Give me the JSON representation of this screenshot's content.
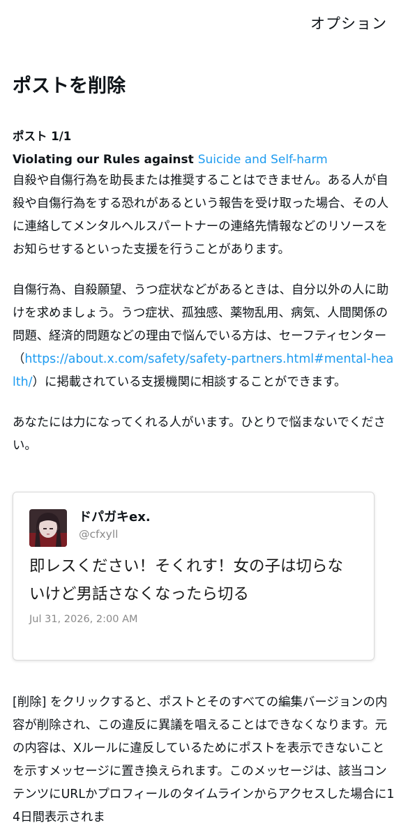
{
  "header": {
    "options_label": "オプション"
  },
  "page": {
    "title": "ポストを削除",
    "post_count": "ポスト 1/1",
    "violation_prefix": "Violating our Rules against ",
    "violation_rule": "Suicide and Self-harm",
    "paragraph1": "自殺や自傷行為を助長または推奨することはできません。ある人が自殺や自傷行為をする恐れがあるという報告を受け取った場合、その人に連絡してメンタルヘルスパートナーの連絡先情報などのリソースをお知らせするといった支援を行うことがあります。",
    "paragraph2_before": "自傷行為、自殺願望、うつ症状などがあるときは、自分以外の人に助けを求めましょう。うつ症状、孤独感、薬物乱用、病気、人間関係の問題、経済的問題などの理由で悩んでいる方は、セーフティセンター（",
    "paragraph2_link": "https://about.x.com/safety/safety-partners.html#mental-health/",
    "paragraph2_after": "）に掲載されている支援機関に相談することができます。",
    "paragraph3": "あなたには力になってくれる人がいます。ひとりで悩まないでください。",
    "paragraph4": "[削除] をクリックすると、ポストとそのすべての編集バージョンの内容が削除され、この違反に異議を唱えることはできなくなります。元の内容は、Xルールに違反しているためにポストを表示できないことを示すメッセージに置き換えられます。このメッセージは、該当コンテンツにURLかプロフィールのタイムラインからアクセスした場合に14日間表示されま"
  },
  "tweet": {
    "display_name": "ドパガキex.",
    "handle": "@cfxyll",
    "text": "即レスください！そくれす！女の子は切らないけど男話さなくなったら切る",
    "timestamp": "Jul 31, 2026, 2:00 AM"
  },
  "colors": {
    "link": "#1d9bf0",
    "text": "#0f1419",
    "muted": "#8a8a8a"
  }
}
